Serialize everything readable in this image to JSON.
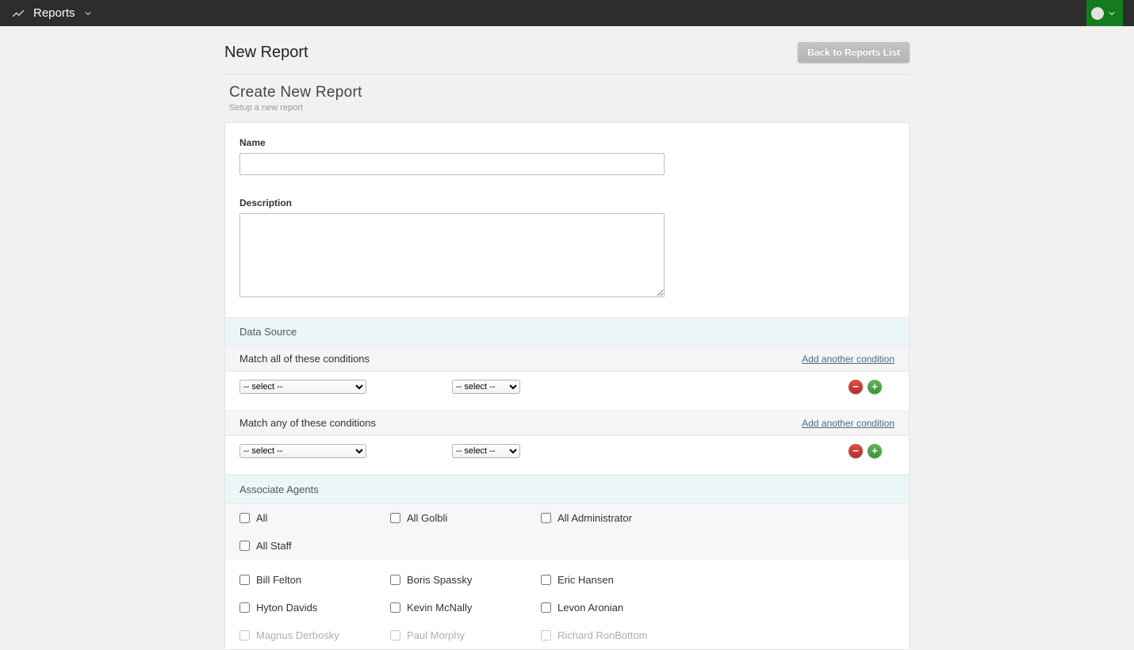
{
  "header": {
    "title": "Reports"
  },
  "page": {
    "title": "New Report",
    "back_button": "Back to Reports List",
    "section_title": "Create New Report",
    "section_sub": "Setup a new report"
  },
  "form": {
    "name_label": "Name",
    "name_value": "",
    "desc_label": "Description",
    "desc_value": ""
  },
  "data_source": {
    "header": "Data Source",
    "match_all_label": "Match all of these conditions",
    "match_any_label": "Match any of these conditions",
    "add_condition_label": "Add another condition",
    "select_placeholder": "-- select --"
  },
  "agents": {
    "header": "Associate Agents",
    "groups": [
      [
        "All",
        "All Golbli",
        "All Administrator"
      ],
      [
        "All Staff",
        "",
        ""
      ]
    ],
    "people": [
      [
        "Bill Felton",
        "Boris Spassky",
        "Eric Hansen"
      ],
      [
        "Hyton Davids",
        "Kevin McNally",
        "Levon Aronian"
      ],
      [
        "Magnus Derbosky",
        "Paul Morphy",
        "Richard RonBottom"
      ]
    ]
  }
}
